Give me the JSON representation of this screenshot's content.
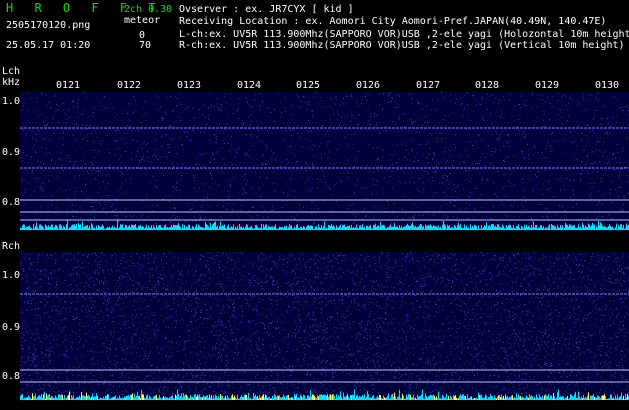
{
  "header": {
    "app_title": "H R O F F T",
    "mode": "2ch 0.30",
    "filename": "2505170120.png",
    "event_label": "meteor",
    "datetime": "25.05.17 01:20",
    "lch_count": "0",
    "rch_count": "70",
    "observer": "Ovserver                : ex. JR7CYX [ kid ]",
    "location": "Receiving Location : ex. Aomori City Aomori-Pref.JAPAN(40.49N, 140.47E)",
    "lch_info": "L-ch:ex. UV5R 113.900Mhz(SAPPORO VOR)USB ,2-ele yagi (Holozontal 10m height",
    "rch_info": "R-ch:ex. UV5R 113.900Mhz(SAPPORO VOR)USB ,2-ele yagi (Vertical 10m height)"
  },
  "lch": {
    "label": "Lch",
    "unit": "kHz",
    "y_ticks": [
      "1.0",
      "0.9",
      "0.8"
    ]
  },
  "rch": {
    "label": "Rch",
    "y_ticks": [
      "1.0",
      "0.9",
      "0.8"
    ]
  },
  "time_ticks": [
    "0121",
    "0122",
    "0123",
    "0124",
    "0125",
    "0126",
    "0127",
    "0128",
    "0129",
    "0130"
  ],
  "colors": {
    "background": "#000000",
    "waterfall": "#00003a",
    "title": "#00e000",
    "signal_line": "#8080ff",
    "activity": "#00e0ff",
    "meteor": "#ffff40"
  }
}
